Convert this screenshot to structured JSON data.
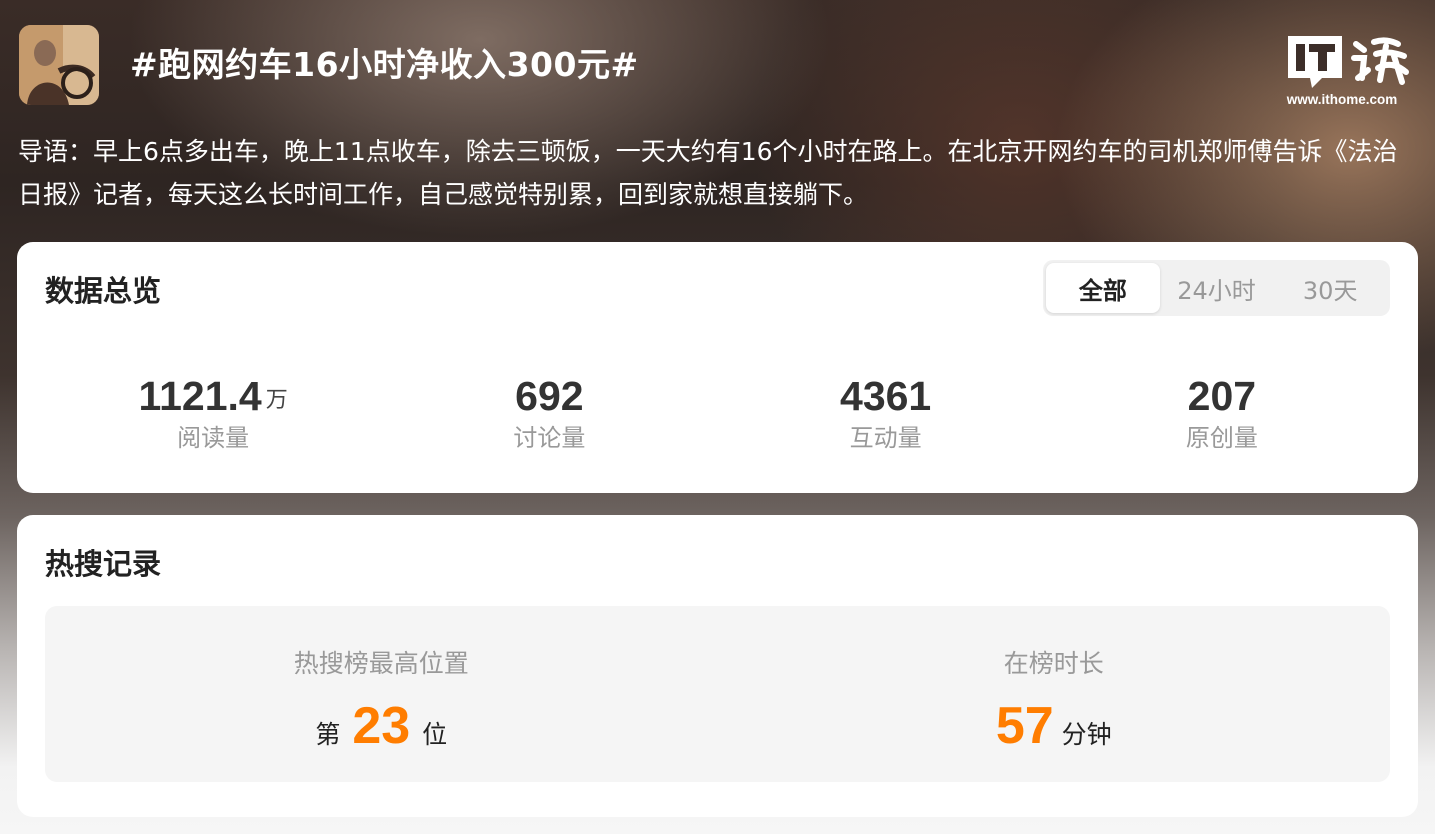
{
  "header": {
    "title": "#跑网约车16小时净收入300元#",
    "brand_url": "www.ithome.com"
  },
  "intro": "导语：早上6点多出车，晚上11点收车，除去三顿饭，一天大约有16个小时在路上。在北京开网约车的司机郑师傅告诉《法治日报》记者，每天这么长时间工作，自己感觉特别累，回到家就想直接躺下。",
  "overview": {
    "title": "数据总览",
    "tabs": [
      "全部",
      "24小时",
      "30天"
    ],
    "active_tab": "全部",
    "stats": [
      {
        "value": "1121.4",
        "unit": "万",
        "label": "阅读量"
      },
      {
        "value": "692",
        "unit": "",
        "label": "讨论量"
      },
      {
        "value": "4361",
        "unit": "",
        "label": "互动量"
      },
      {
        "value": "207",
        "unit": "",
        "label": "原创量"
      }
    ]
  },
  "hot_search": {
    "title": "热搜记录",
    "peak": {
      "label": "热搜榜最高位置",
      "prefix": "第",
      "value": "23",
      "suffix": "位"
    },
    "duration": {
      "label": "在榜时长",
      "value": "57",
      "suffix": "分钟"
    },
    "accent_color": "#ff7d00"
  }
}
